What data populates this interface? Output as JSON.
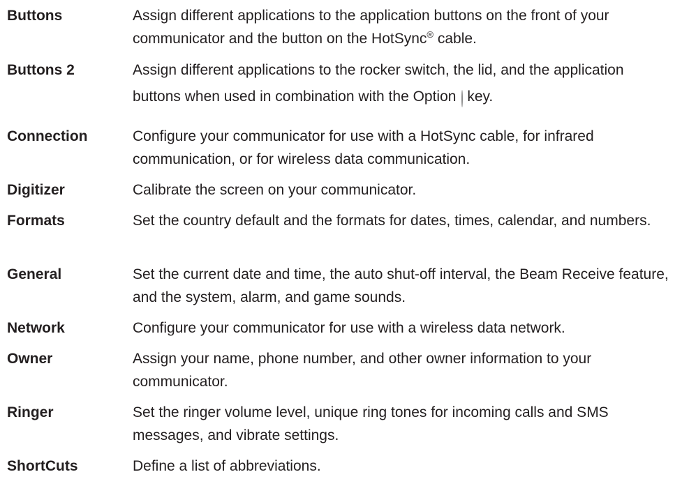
{
  "definitions": [
    {
      "term": "Buttons",
      "desc_part1": "Assign different applications to the application buttons on the front of your communicator and the button on the HotSync",
      "desc_symbol": "®",
      "desc_part2": " cable."
    },
    {
      "term": "Buttons 2",
      "desc_part1": "Assign different applications to the rocker switch, the lid, and the application buttons when used in combination with the Option",
      "desc_icon": "option-key-icon",
      "desc_part2": "key."
    },
    {
      "term": "Connection",
      "desc": "Configure your communicator for use with a HotSync cable, for infrared communication, or for wireless data communication."
    },
    {
      "term": "Digitizer",
      "desc": "Calibrate the screen on your communicator."
    },
    {
      "term": "Formats",
      "desc": "Set the country default and the formats for dates, times, calendar, and numbers."
    },
    {
      "term": "General",
      "desc": "Set the current date and time, the auto shut-off interval, the Beam Receive feature, and the system, alarm, and game sounds."
    },
    {
      "term": "Network",
      "desc": "Configure your communicator for use with a wireless data network."
    },
    {
      "term": "Owner",
      "desc": "Assign your name, phone number, and other owner information to your communicator."
    },
    {
      "term": "Ringer",
      "desc": "Set the ringer volume level, unique ring tones for incoming calls and SMS messages, and vibrate settings."
    },
    {
      "term": "ShortCuts",
      "desc": "Define a list of abbreviations."
    }
  ]
}
